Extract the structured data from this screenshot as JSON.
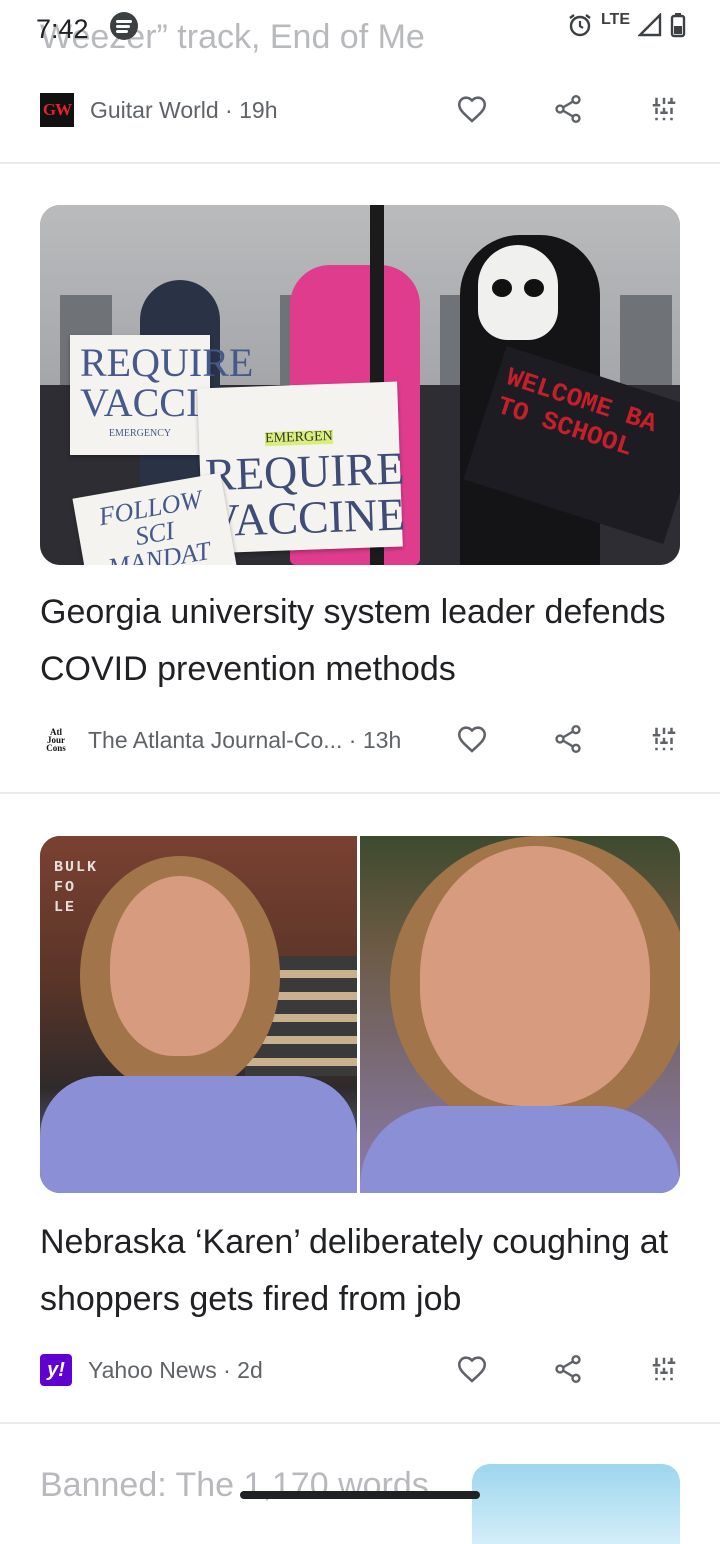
{
  "status_bar": {
    "time": "7:42",
    "network": "LTE"
  },
  "top_card": {
    "title_tail": "Weezer” track, End of Me",
    "source": "Guitar World",
    "age": "19h",
    "logo_text": "GW"
  },
  "cards": [
    {
      "title": "Georgia university system leader defends COVID prevention methods",
      "source": "The Atlanta Journal-Co...",
      "age": "13h",
      "logo_text": "Atl Jour Cons",
      "image_text": {
        "sign1": "REQUIRE VACCIN",
        "sign1_small": "EMERGENCY",
        "sign2": "REQUIRE VACCINE",
        "sign2_small": "EMERGEN",
        "sign3": "FOLLOW SCI MANDAT MASKS",
        "black_sign": "WELCOME BA TO SCHOOL"
      }
    },
    {
      "title": "Nebraska ‘Karen’ deliberately coughing at shoppers gets fired from job",
      "source": "Yahoo News",
      "age": "2d",
      "logo_text": "y!",
      "image_text": {
        "store_sign": "BULK FO LE"
      }
    }
  ],
  "peek_card": {
    "title": "Banned: The 1,170 words"
  },
  "separator": " · ",
  "colors": {
    "yahoo": "#5f01d1",
    "gw_red": "#e3222b",
    "text": "#202124",
    "meta": "#5f6368"
  }
}
